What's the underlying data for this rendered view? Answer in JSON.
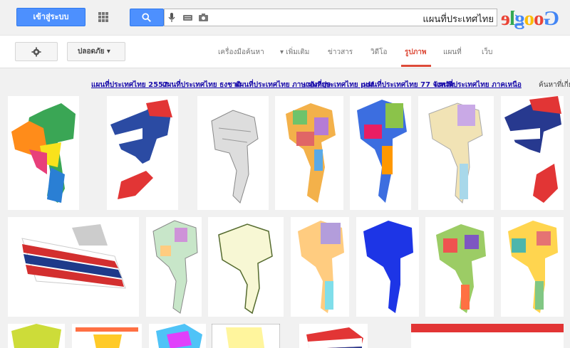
{
  "search": {
    "query": "แผนที่ประเทศไทย",
    "button_label": "search"
  },
  "header": {
    "signin_label": "เข้าสู่ระบบ",
    "logo_text": "Google"
  },
  "toolbar": {
    "safesearch_label": "ปลอดภัย ▾"
  },
  "tabs": [
    {
      "label": "เว็บ",
      "active": false
    },
    {
      "label": "แผนที่",
      "active": false
    },
    {
      "label": "รูปภาพ",
      "active": true
    },
    {
      "label": "วิดีโอ",
      "active": false
    },
    {
      "label": "ข่าวสาร",
      "active": false
    },
    {
      "label": "▾ เพิ่มเติม",
      "active": false
    },
    {
      "label": "เครื่องมือค้นหา",
      "active": false
    }
  ],
  "related": {
    "label": "ค้นหาที่เกี่ยวข้อง:",
    "items": [
      "แผนที่ประเทศไทย ภาคเหนือ",
      "แผนที่ประเทศไทย 77 จังหวัด",
      "แผนที่ประเทศไทย pdf",
      "แผนที่ประเทศไทย ภาษาอังกฤษ",
      "แผนที่ประเทศไทย ธงชาติ",
      "แผนที่ประเทศไทย 2557"
    ]
  },
  "colors": {
    "blue_button": "#4d90fe",
    "active_tab": "#dd4b39",
    "link": "#1a0dab"
  }
}
